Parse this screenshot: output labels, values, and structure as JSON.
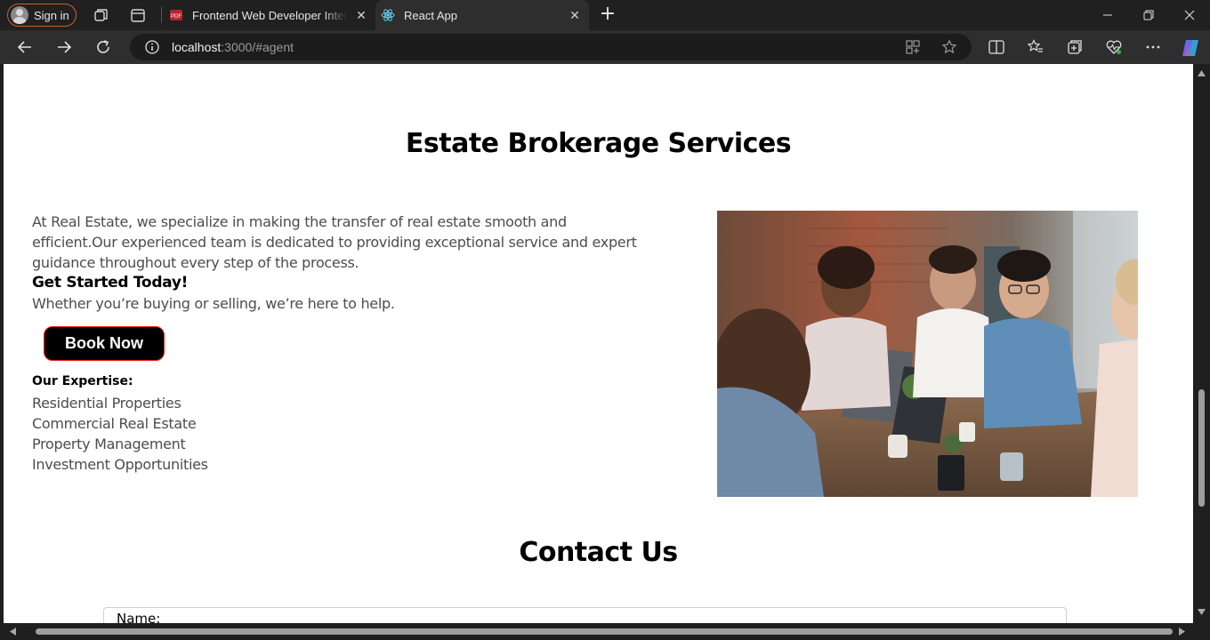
{
  "browser": {
    "sign_in_label": "Sign in",
    "tabs": [
      {
        "label": "Frontend Web Developer Internship",
        "favicon": "pdf-icon",
        "active": false
      },
      {
        "label": "React App",
        "favicon": "react-icon",
        "active": true
      }
    ],
    "address": {
      "host": "localhost",
      "rest": ":3000/#agent"
    }
  },
  "page": {
    "brokerage_title": "Estate Brokerage Services",
    "intro": "At Real Estate, we specialize in making the transfer of real estate smooth and efficient.Our experienced team is dedicated to providing exceptional service and expert guidance throughout every step of the process.",
    "get_started": "Get Started Today!",
    "sub_text": "Whether you’re buying or selling, we’re here to help.",
    "book_button": "Book Now",
    "expertise_heading": "Our Expertise:",
    "expertise_items": [
      "Residential Properties",
      "Commercial Real Estate",
      "Property Management",
      "Investment Opportunities"
    ],
    "contact_title": "Contact Us",
    "name_label": "Name:"
  },
  "colors": {
    "accent_border": "#ff1a1a",
    "signin_border": "#c8622f",
    "body_text": "#4d4d4d"
  }
}
